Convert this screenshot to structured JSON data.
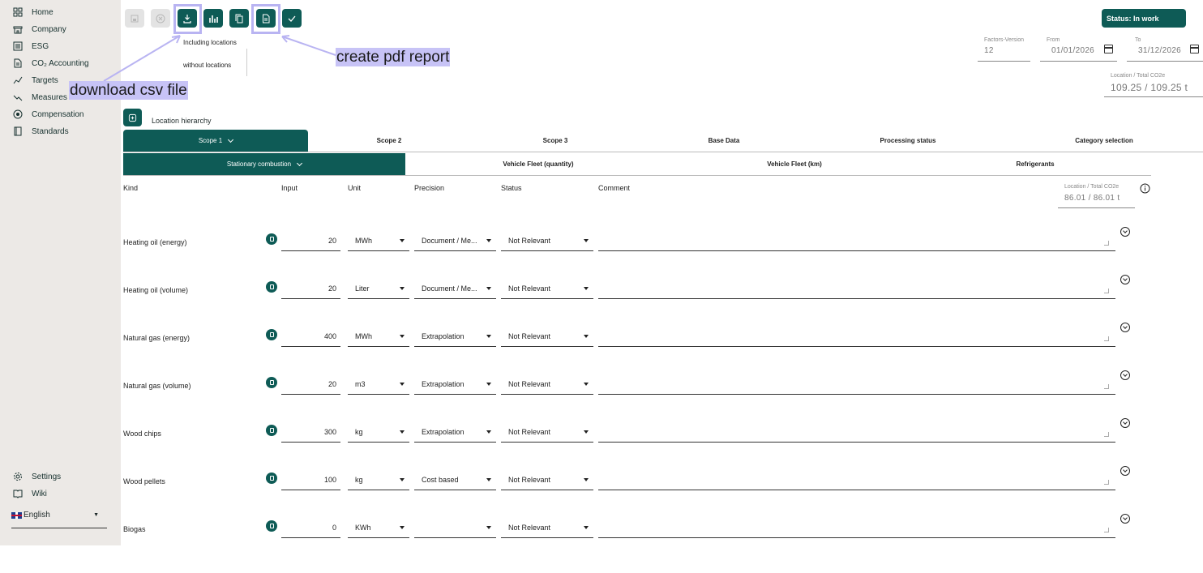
{
  "sidebar": {
    "items": [
      {
        "label": "Home",
        "icon": "grid-icon"
      },
      {
        "label": "Company",
        "icon": "building-icon"
      },
      {
        "label": "ESG",
        "icon": "list-icon"
      },
      {
        "label": "CO₂ Accounting",
        "icon": "document-icon"
      },
      {
        "label": "Targets",
        "icon": "chart-line-icon"
      },
      {
        "label": "Measures",
        "icon": "trend-down-icon"
      },
      {
        "label": "Compensation",
        "icon": "leaf-circle-icon"
      },
      {
        "label": "Standards",
        "icon": "book-icon"
      }
    ],
    "bottom_items": [
      {
        "label": "Settings",
        "icon": "gear-icon"
      },
      {
        "label": "Wiki",
        "icon": "book-open-icon"
      }
    ],
    "language": "English"
  },
  "toolbar": {
    "export_menu": [
      "Including locations",
      "without locations"
    ],
    "status_label": "Status: In work"
  },
  "annotations": {
    "csv": "download csv file",
    "pdf": "create pdf report"
  },
  "header_fields": {
    "factors_label": "Factors-Version",
    "factors_value": "12",
    "from_label": "From",
    "from_value": "01/01/2026",
    "to_label": "To",
    "to_value": "31/12/2026",
    "total_label": "Location / Total CO2e",
    "total_value": "109.25 / 109.25 t"
  },
  "location_hierarchy": "Location hierarchy",
  "tabs": [
    "Scope 1",
    "Scope 2",
    "Scope 3",
    "Base Data",
    "Processing status",
    "Category selection"
  ],
  "subtabs": [
    "Stationary combustion",
    "Vehicle Fleet (quantity)",
    "Vehicle Fleet (km)",
    "Refrigerants"
  ],
  "columns": {
    "kind": "Kind",
    "input": "Input",
    "unit": "Unit",
    "precision": "Precision",
    "status": "Status",
    "comment": "Comment",
    "total_label": "Location / Total CO2e",
    "total_value": "86.01 / 86.01 t"
  },
  "rows": [
    {
      "kind": "Heating oil (energy)",
      "input": "20",
      "unit": "MWh",
      "precision": "Document / Me...",
      "status": "Not Relevant"
    },
    {
      "kind": "Heating oil (volume)",
      "input": "20",
      "unit": "Liter",
      "precision": "Document / Me...",
      "status": "Not Relevant"
    },
    {
      "kind": "Natural gas (energy)",
      "input": "400",
      "unit": "MWh",
      "precision": "Extrapolation",
      "status": "Not Relevant"
    },
    {
      "kind": "Natural gas (volume)",
      "input": "20",
      "unit": "m3",
      "precision": "Extrapolation",
      "status": "Not Relevant"
    },
    {
      "kind": "Wood chips",
      "input": "300",
      "unit": "kg",
      "precision": "Extrapolation",
      "status": "Not Relevant"
    },
    {
      "kind": "Wood pellets",
      "input": "100",
      "unit": "kg",
      "precision": "Cost based",
      "status": "Not Relevant"
    },
    {
      "kind": "Biogas",
      "input": "0",
      "unit": "KWh",
      "precision": "",
      "status": "Not Relevant"
    }
  ],
  "colors": {
    "accent": "#0e5b56",
    "annotation": "#c7c3f6",
    "sidebar": "#ece9e6"
  }
}
